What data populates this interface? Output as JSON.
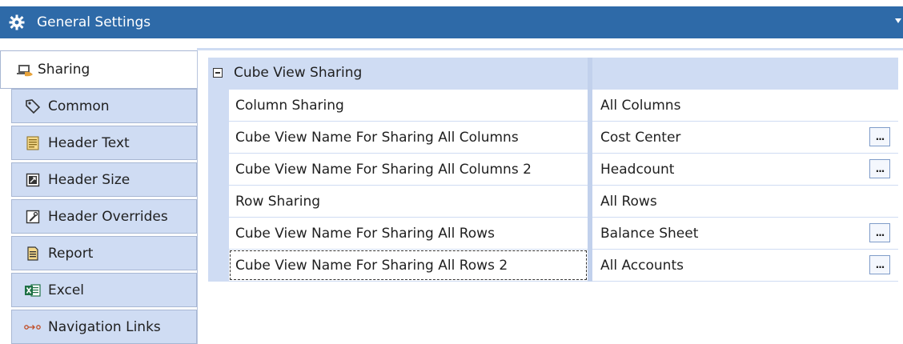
{
  "title": {
    "text": "General Settings",
    "icon": "gear-icon"
  },
  "colors": {
    "titlebar": "#2e6aa8",
    "tab_bg": "#cfdcf3",
    "grid_bg": "#cfdcf3",
    "button_border": "#7f9cc9"
  },
  "sidebar": {
    "items": [
      {
        "label": "Sharing",
        "icon": "sharing-icon",
        "active": true
      },
      {
        "label": "Common",
        "icon": "tag-icon",
        "active": false
      },
      {
        "label": "Header Text",
        "icon": "header-text-icon",
        "active": false
      },
      {
        "label": "Header Size",
        "icon": "header-size-icon",
        "active": false
      },
      {
        "label": "Header Overrides",
        "icon": "header-overrides-icon",
        "active": false
      },
      {
        "label": "Report",
        "icon": "report-icon",
        "active": false
      },
      {
        "label": "Excel",
        "icon": "excel-icon",
        "active": false
      },
      {
        "label": "Navigation Links",
        "icon": "navigation-links-icon",
        "active": false
      }
    ]
  },
  "grid": {
    "category": "Cube View Sharing",
    "rows": [
      {
        "name": "Column Sharing",
        "value": "All Columns",
        "has_button": false
      },
      {
        "name": "Cube View Name For Sharing All Columns",
        "value": "Cost Center",
        "has_button": true
      },
      {
        "name": "Cube View Name For Sharing All Columns 2",
        "value": "Headcount",
        "has_button": true
      },
      {
        "name": "Row Sharing",
        "value": "All Rows",
        "has_button": false
      },
      {
        "name": "Cube View Name For Sharing All Rows",
        "value": "Balance Sheet",
        "has_button": true
      },
      {
        "name": "Cube View Name For Sharing All Rows 2",
        "value": "All Accounts",
        "has_button": true
      }
    ],
    "button_label": "..."
  }
}
